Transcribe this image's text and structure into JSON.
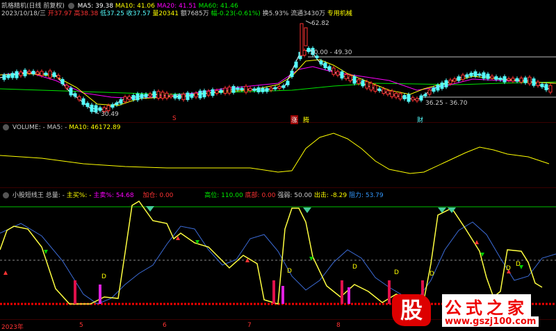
{
  "main_panel": {
    "title": "凯格精机(日线 前复权)",
    "ma5": "MA5: 39.38",
    "ma10": "MA10: 41.06",
    "ma20": "MA20: 41.51",
    "ma60": "MA60: 41.46",
    "date": "2023/10/18/三",
    "open": "开37.97",
    "high": "高38.38",
    "low": "低37.25",
    "close": "收37.57",
    "volume": "量20341",
    "amount": "额7685万",
    "change": "幅-0.23(-0.61%)",
    "turnover": "换5.93%",
    "float": "流通3430万",
    "sector": "专用机械",
    "label_high": "62.82",
    "label_range1": "50.00 - 49.30",
    "label_range2": "36.25 - 36.70",
    "label_low": "30.49",
    "marker_s": "S",
    "marker_zhang": "涨",
    "marker_teng": "腾",
    "marker_cai": "财"
  },
  "volume_panel": {
    "title": "VOLUME: -",
    "ma5": "MA5: -",
    "ma10": "MA10: 46172.89"
  },
  "indicator_panel": {
    "title": "小股短线王",
    "total": "总量: -",
    "buy_pct": "主买%: -",
    "sell_pct": "主卖%: 54.68",
    "add": "加仓: 0.00",
    "high": "高位: 110.00",
    "bottom": "底部: 0.00",
    "strength": "强弱: 50.00",
    "exit": "出击: -8.29",
    "resist": "阻力: 53.79",
    "d_marks": [
      "D",
      "D",
      "D",
      "D",
      "D",
      "D",
      "D"
    ]
  },
  "x_axis": [
    "2023年",
    "5",
    "6",
    "7",
    "8"
  ],
  "colors": {
    "up": "#ff3232",
    "down": "#54fcfc",
    "ma5": "#ffffff",
    "ma10": "#ffff00",
    "ma20": "#ff00ff",
    "ma60": "#00e600",
    "signal": "#ffff40",
    "blue_line": "#3c6cd8"
  },
  "watermark": {
    "logo_char": "股",
    "title": "公式之家",
    "url": "www.gszj100.com"
  }
}
